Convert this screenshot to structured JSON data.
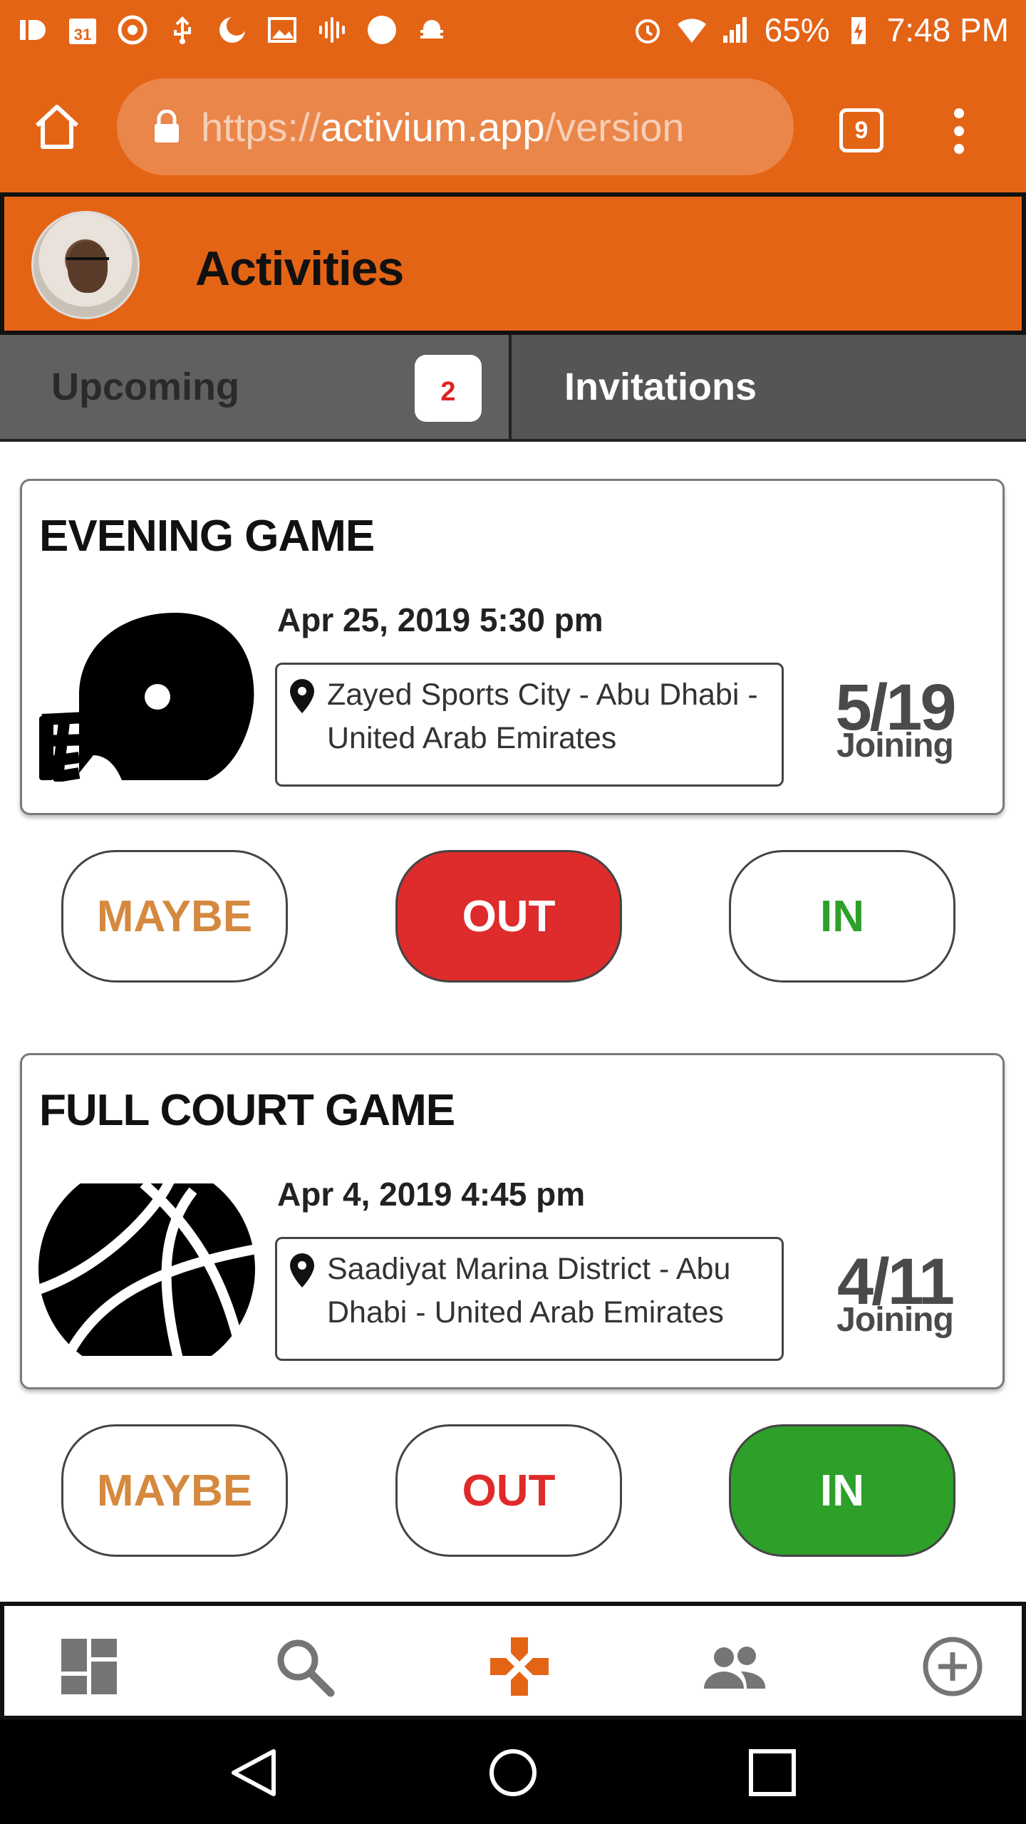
{
  "status_bar": {
    "battery": "65%",
    "time": "7:48 PM",
    "calendar_day": "31"
  },
  "browser": {
    "url_scheme": "https://",
    "url_host": "activium.app",
    "url_path": "/version",
    "tab_count": "9"
  },
  "header": {
    "title": "Activities"
  },
  "tabs": {
    "upcoming_label": "Upcoming",
    "upcoming_badge": "2",
    "invitations_label": "Invitations"
  },
  "activities": [
    {
      "title": "EVENING GAME",
      "icon": "football-helmet-icon",
      "date": "Apr 25, 2019 5:30 pm",
      "location": "Zayed Sports City - Abu Dhabi - United Arab Emirates",
      "joining_count": "5/19",
      "joining_label": "Joining",
      "rsvp": {
        "maybe": "MAYBE",
        "out": "OUT",
        "in": "IN",
        "selected": "OUT"
      }
    },
    {
      "title": "FULL COURT GAME",
      "icon": "basketball-icon",
      "date": "Apr 4, 2019 4:45 pm",
      "location": "Saadiyat Marina District - Abu Dhabi - United Arab Emirates",
      "joining_count": "4/11",
      "joining_label": "Joining",
      "rsvp": {
        "maybe": "MAYBE",
        "out": "OUT",
        "in": "IN",
        "selected": "IN"
      }
    }
  ],
  "bottom_nav": [
    {
      "icon": "dashboard-icon",
      "active": false
    },
    {
      "icon": "search-icon",
      "active": false
    },
    {
      "icon": "gamepad-icon",
      "active": true
    },
    {
      "icon": "people-icon",
      "active": false
    },
    {
      "icon": "add-circle-icon",
      "active": false
    }
  ],
  "colors": {
    "brand": "#e46416",
    "tab_bg": "#5e5e5e",
    "out_active": "#de2b2b",
    "in_active": "#2ea02a",
    "maybe": "#d5893f",
    "nav_icon": "#757575",
    "nav_active": "#e46416"
  }
}
